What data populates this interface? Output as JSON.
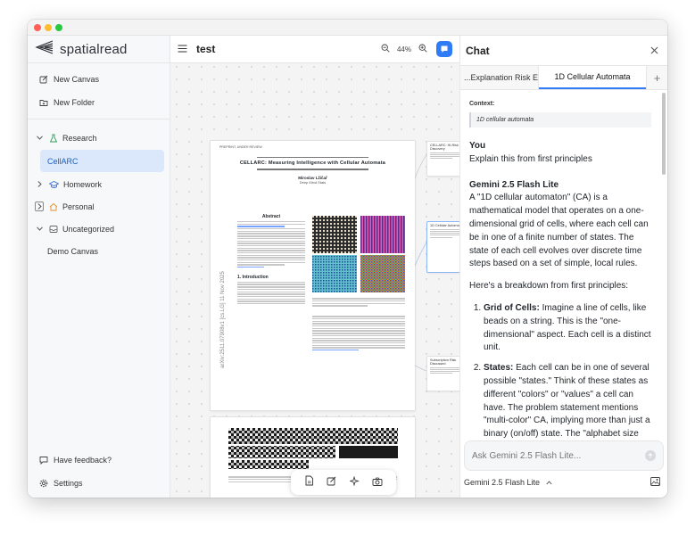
{
  "app": {
    "name": "spatialread"
  },
  "sidebar": {
    "actions": [
      {
        "label": "New Canvas"
      },
      {
        "label": "New Folder"
      }
    ],
    "tree": {
      "research": {
        "label": "Research"
      },
      "cellarc": {
        "label": "CellARC"
      },
      "homework": {
        "label": "Homework"
      },
      "personal": {
        "label": "Personal"
      },
      "uncategorized": {
        "label": "Uncategorized"
      },
      "demo_canvas": {
        "label": "Demo Canvas"
      }
    },
    "bottom": [
      {
        "label": "Have feedback?"
      },
      {
        "label": "Settings"
      }
    ]
  },
  "canvas": {
    "title": "test",
    "zoom": "44%",
    "paper": {
      "header": "PREPRINT, UNDER REVIEW",
      "title": "CELLARC: Measuring Intelligence with Cellular Automata",
      "author": "Miroslav Lžičař",
      "affiliation": "Deep Mind Stats",
      "abstract_heading": "Abstract",
      "arxiv_stamp": "arXiv:2511.07908v1 [cs.LG] 11 Nov 2025",
      "intro_heading": "1. Introduction"
    },
    "cards": [
      {
        "title": "CELLARC: Hi-Risk Discovery"
      },
      {
        "title": "1D Cellular Automata"
      },
      {
        "title": "Subscription Risk Discussed"
      }
    ]
  },
  "chat": {
    "title": "Chat",
    "tabs": [
      {
        "label": "Explanation Risk Expl..."
      },
      {
        "label": "1D Cellular Automata"
      }
    ],
    "context_label": "Context:",
    "context_value": "1D cellular automata",
    "user": {
      "name": "You",
      "text": "Explain this from first principles"
    },
    "assistant": {
      "name": "Gemini 2.5 Flash Lite",
      "intro": "A \"1D cellular automaton\" (CA) is a mathematical model that operates on a one-dimensional grid of cells, where each cell can be in one of a finite number of states. The state of each cell evolves over discrete time steps based on a set of simple, local rules.",
      "breakdown": "Here's a breakdown from first principles:",
      "items": [
        {
          "term": "Grid of Cells:",
          "text": " Imagine a line of cells, like beads on a string. This is the \"one-dimensional\" aspect. Each cell is a distinct unit."
        },
        {
          "term": "States:",
          "text": " Each cell can be in one of several possible \"states.\" Think of these states as different \"colors\" or \"values\" a cell can have. The problem statement mentions \"multi-color\" CA, implying more than just a binary (on/off) state. The \"alphabet size"
        }
      ]
    },
    "input_placeholder": "Ask Gemini 2.5 Flash Lite...",
    "model": "Gemini 2.5 Flash Lite"
  },
  "colors": {
    "accent": "#2f7cf6",
    "selected_bg": "#dbe8fb"
  }
}
